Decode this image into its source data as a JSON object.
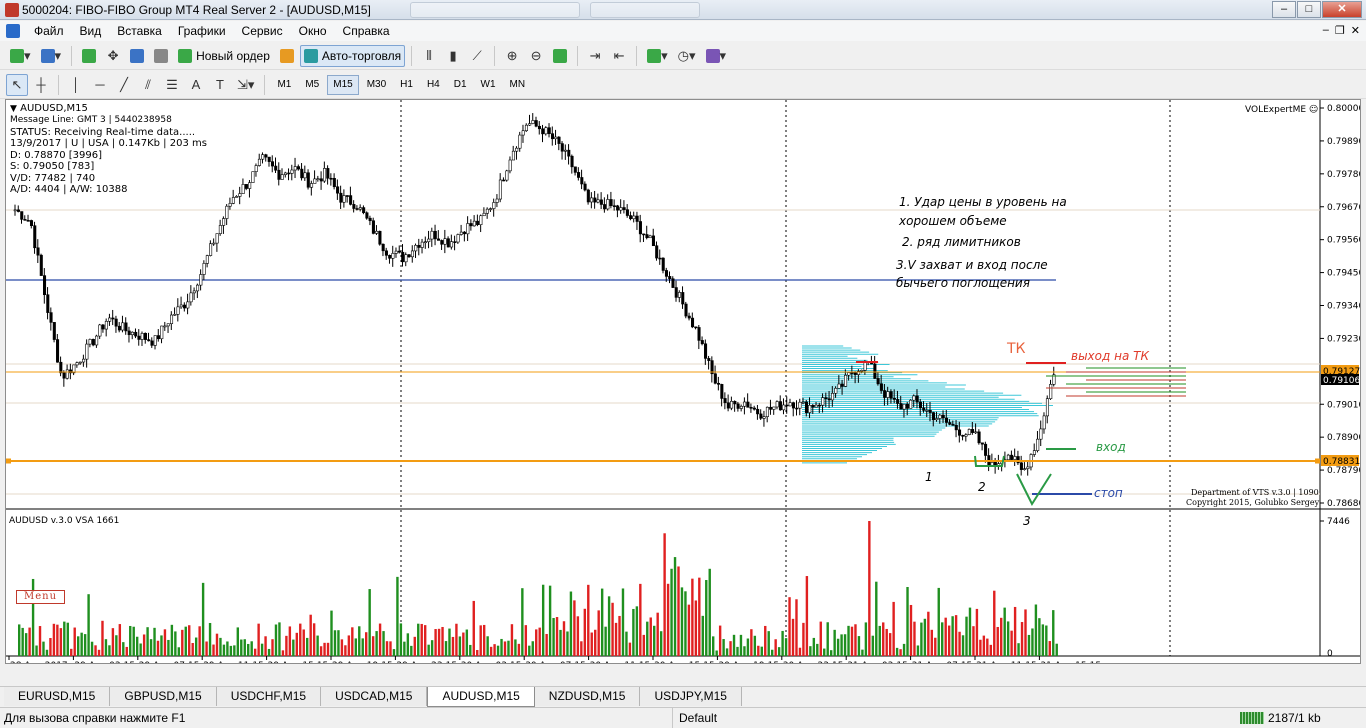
{
  "window": {
    "title": "5000204: FIBO-FIBO Group MT4 Real Server 2 - [AUDUSD,M15]",
    "buttons": {
      "minimize": "–",
      "maximize": "□",
      "close": "✕"
    }
  },
  "menu": {
    "items": [
      "Файл",
      "Вид",
      "Вставка",
      "Графики",
      "Сервис",
      "Окно",
      "Справка"
    ],
    "mdi": {
      "minimize": "–",
      "restore": "❐",
      "close": "✕"
    }
  },
  "toolbar": {
    "new_order": "Новый ордер",
    "autotrading": "Авто-торговля"
  },
  "timeframes": {
    "items": [
      "M1",
      "M5",
      "M15",
      "M30",
      "H1",
      "H4",
      "D1",
      "W1",
      "MN"
    ],
    "active": "M15"
  },
  "chart": {
    "symbol_title": "AUDUSD,M15",
    "info_lines": [
      "Message Line: GMT 3 | 5440238958",
      "STATUS:  Receiving Real-time data.....",
      "13/9/2017 | U | USA | 0.147Kb | 203 ms",
      "D: 0.78870  [3996]",
      "S: 0.79050  [783]",
      "V/D: 77482 | 740",
      "A/D: 4404 | A/W: 10388"
    ],
    "expert": "VOLExpertME ☺",
    "menu_badge": "Menu",
    "copyright_1": "Department of VTS  v.3.0 | 1090",
    "copyright_2": "Copyright 2015, Golubko Sergey",
    "indicator_label": "AUDUSD v.3.0 VSA 1661",
    "indicator_max": "7446",
    "indicator_min": "0",
    "price_labels": [
      "0.80000",
      "0.79890",
      "0.79780",
      "0.79670",
      "0.79560",
      "0.79450",
      "0.79340",
      "0.79230",
      "0.79010",
      "0.78900",
      "0.78790",
      "0.78680"
    ],
    "price_current_1": "0.79127",
    "price_current_2": "0.79106",
    "price_current_3": "0.78831",
    "time_labels": [
      "28 Aug 2017",
      "29 Aug 03:15",
      "29 Aug 07:15",
      "29 Aug 11:15",
      "29 Aug 15:15",
      "29 Aug 19:15",
      "29 Aug 23:15",
      "30 Aug 03:15",
      "30 Aug 07:15",
      "30 Aug 11:15",
      "30 Aug 15:15",
      "30 Aug 19:15",
      "30 Aug 23:15",
      "31 Aug 03:15",
      "31 Aug 07:15",
      "31 Aug 11:15",
      "31 Aug 15:15"
    ],
    "colors": {
      "bull": "#1f8f1f",
      "bear": "#e02020",
      "profile": "#3dc7d8",
      "level_blue": "#2b4aa8",
      "level_orange": "#f39c12"
    }
  },
  "annotations": {
    "note_1": "1. Удар цены в уровень на",
    "note_1b": "хорошем объеме",
    "note_2": "2. ряд лимитников",
    "note_3": "3.V захват и вход после",
    "note_3b": "бычьего поглощения",
    "tk": "ТК",
    "exit_tk": "выход на ТК",
    "entry": "вход",
    "stop": "стоп",
    "mark_1": "1",
    "mark_2": "2",
    "mark_3": "3"
  },
  "tabs": {
    "items": [
      "EURUSD,M15",
      "GBPUSD,M15",
      "USDCHF,M15",
      "USDCAD,M15",
      "AUDUSD,M15",
      "NZDUSD,M15",
      "USDJPY,M15"
    ],
    "active": "AUDUSD,M15"
  },
  "status": {
    "help": "Для вызова справки нажмите F1",
    "profile": "Default",
    "connection": "2187/1 kb"
  }
}
